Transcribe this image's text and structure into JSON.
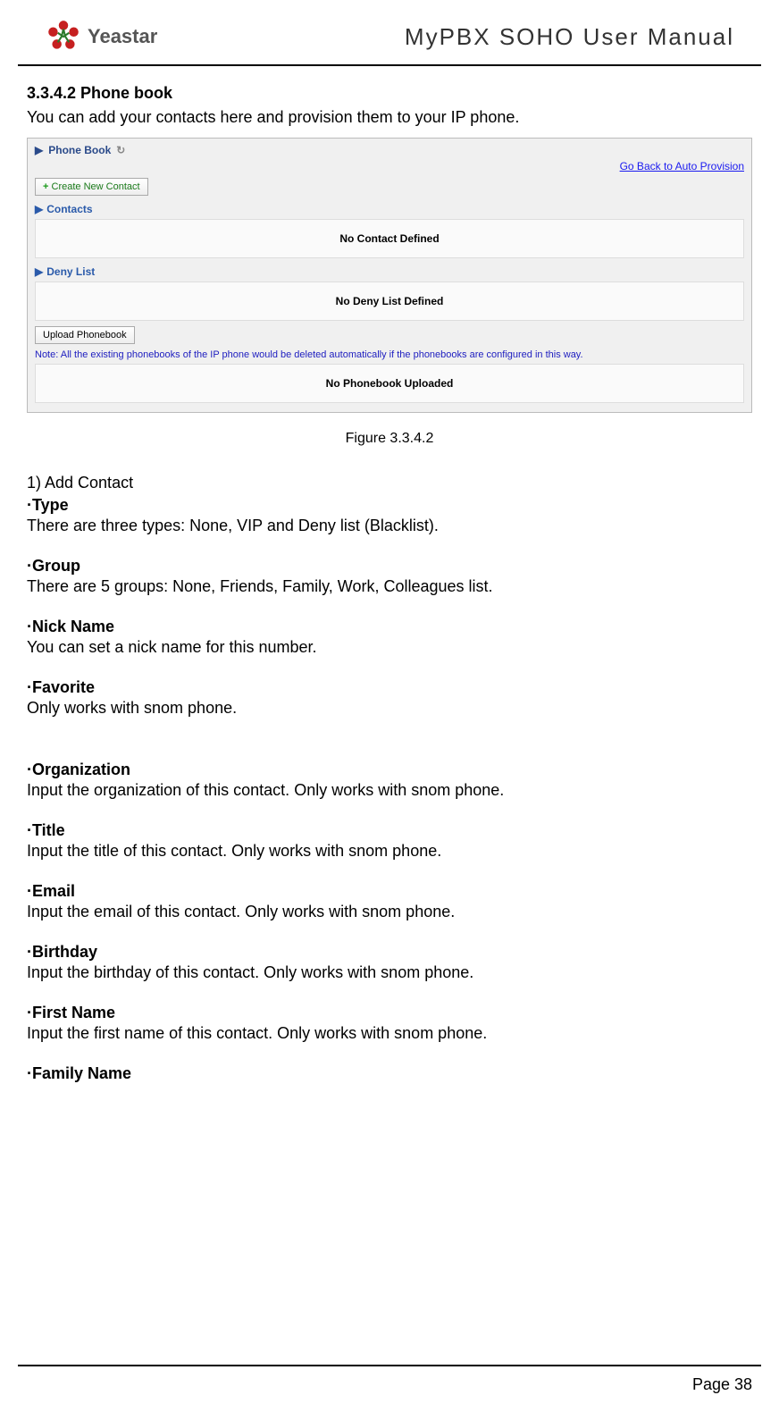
{
  "header": {
    "brand": "Yeastar",
    "doc_title": "MyPBX SOHO User Manual"
  },
  "section": {
    "heading": "3.3.4.2 Phone book",
    "intro": "You can add your contacts here and provision them to your IP phone."
  },
  "screenshot": {
    "title": "Phone Book",
    "back_link": "Go Back to Auto Provision",
    "create_btn": "Create New Contact",
    "contacts_label": "Contacts",
    "contacts_empty": "No Contact Defined",
    "denylist_label": "Deny List",
    "denylist_empty": "No Deny List Defined",
    "upload_btn": "Upload Phonebook",
    "note": "Note: All the existing phonebooks of the IP phone would be deleted automatically if the phonebooks are configured in this way.",
    "phonebook_empty": "No Phonebook Uploaded"
  },
  "figure_caption": "Figure 3.3.4.2",
  "list_item": "1)  Add Contact",
  "fields": {
    "type": {
      "label": "·Type",
      "desc": "There are three types: None, VIP and Deny list (Blacklist)."
    },
    "group": {
      "label": "·Group",
      "desc": "There are 5 groups: None, Friends, Family, Work, Colleagues list."
    },
    "nick": {
      "label": "·Nick Name",
      "desc": "You can set a nick name for this number."
    },
    "favorite": {
      "label": "·Favorite",
      "desc": "Only works with snom phone."
    },
    "organization": {
      "label": "·Organization",
      "desc": "Input the organization of this contact. Only works with snom phone."
    },
    "title": {
      "label": "·Title",
      "desc": "Input the title of this contact. Only works with snom phone."
    },
    "email": {
      "label": "·Email",
      "desc": "Input the email of this contact. Only works with snom phone."
    },
    "birthday": {
      "label": "·Birthday",
      "desc": "Input the birthday of this contact. Only works with snom phone."
    },
    "firstname": {
      "label": "·First Name",
      "desc": "Input the first name of this contact. Only works with snom phone."
    },
    "familyname": {
      "label": "·Family Name"
    }
  },
  "footer": {
    "page": "Page 38"
  }
}
